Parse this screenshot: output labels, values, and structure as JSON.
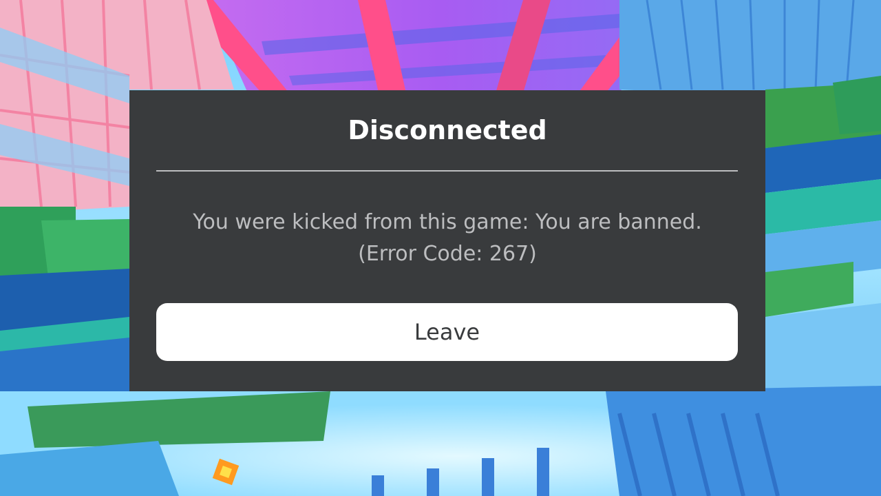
{
  "dialog": {
    "title": "Disconnected",
    "message_line1": "You were kicked from this game: You are banned.",
    "message_line2": "(Error Code: 267)",
    "leave_label": "Leave"
  },
  "colors": {
    "dialog_bg": "#393b3d",
    "title_text": "#ffffff",
    "message_text": "#bdbec0",
    "button_bg": "#ffffff",
    "button_text": "#393b3d"
  }
}
